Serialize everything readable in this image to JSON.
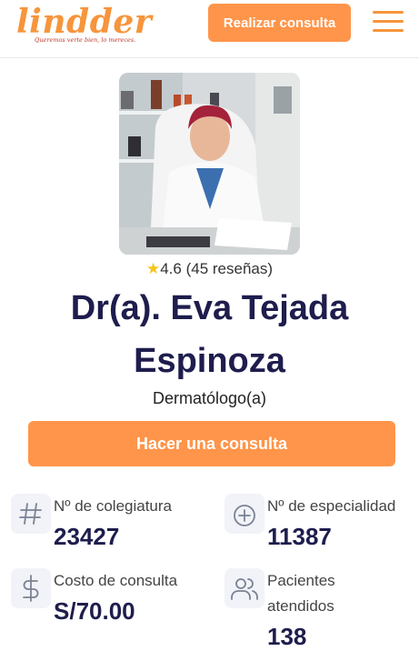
{
  "header": {
    "logo_text": "lindder",
    "logo_tagline": "Queremos verte bien, lo mereces.",
    "cta_label": "Realizar consulta",
    "menu_icon": "hamburger-icon"
  },
  "profile": {
    "rating_value": "4.6",
    "rating_reviews": "(45 reseñas)",
    "name_line1": "Dr(a). Eva Tejada",
    "name_line2": "Espinoza",
    "specialty": "Dermatólogo(a)",
    "cta_label": "Hacer una consulta"
  },
  "stats": {
    "colegiatura": {
      "label": "Nº de colegiatura",
      "value": "23427",
      "icon": "hash-icon"
    },
    "especialidad": {
      "label": "Nº de especialidad",
      "value": "11387",
      "icon": "plus-circle-icon"
    },
    "costo": {
      "label": "Costo de consulta",
      "value": "S/70.00",
      "icon": "dollar-icon"
    },
    "pacientes": {
      "label_line1": "Pacientes",
      "label_line2": "atendidos",
      "value": "138",
      "icon": "users-icon"
    }
  },
  "colors": {
    "accent": "#ff954a",
    "heading": "#1e1d4d",
    "icon_bg": "#f1f3f8",
    "icon_stroke": "#7a8294"
  }
}
